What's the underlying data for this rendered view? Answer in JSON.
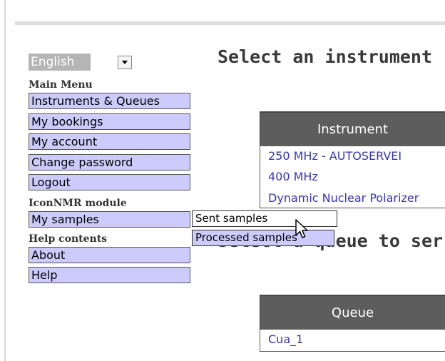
{
  "language": {
    "selected": "English"
  },
  "sections": {
    "main_menu": "Main Menu",
    "iconnmr": "IconNMR module",
    "help": "Help contents"
  },
  "menu": {
    "instruments": "Instruments & Queues",
    "bookings": "My bookings",
    "account": "My account",
    "password": "Change password",
    "logout": "Logout",
    "samples": "My samples",
    "about": "About",
    "help": "Help"
  },
  "popup": {
    "sent": "Sent samples",
    "processed": "Processed samples"
  },
  "main": {
    "heading_instrument": "Select an instrument",
    "heading_queue": "Select a queue to ser",
    "instrument_table": {
      "header": "Instrument",
      "rows": [
        "250 MHz - AUTOSERVEI",
        "400 MHz",
        "Dynamic Nuclear Polarizer"
      ]
    },
    "queue_table": {
      "header": "Queue",
      "rows": [
        "Cua_1"
      ]
    }
  },
  "colors": {
    "menu_bg": "#cccbfb",
    "table_header_bg": "#5d5d5d",
    "link": "#3535b8"
  }
}
